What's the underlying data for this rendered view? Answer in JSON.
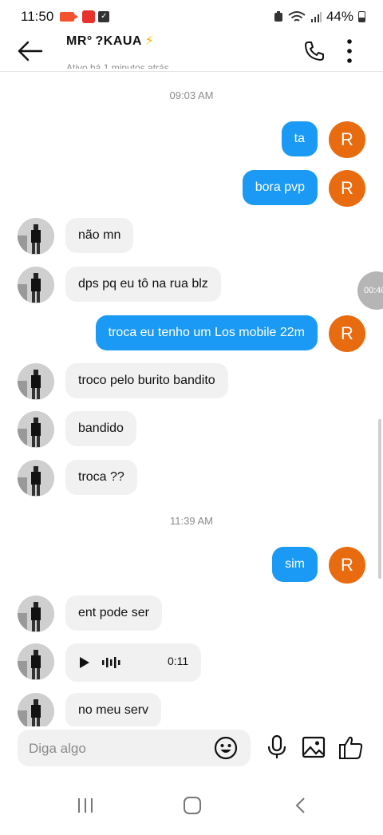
{
  "status_bar": {
    "time": "11:50",
    "battery": "44%"
  },
  "header": {
    "contact_name": "MR° ?KAUA ",
    "bolt": "⚡",
    "contact_status": "Ativo há 1 minutos atrás"
  },
  "chat": {
    "timestamp_1": "09:03 AM",
    "timestamp_2": "11:39 AM",
    "my_avatar_letter": "R",
    "floating_timer": "00:40",
    "messages": [
      {
        "dir": "out",
        "text": "ta"
      },
      {
        "dir": "out",
        "text": "bora pvp"
      },
      {
        "dir": "in",
        "text": "não mn"
      },
      {
        "dir": "in",
        "text": "dps pq eu tô na rua blz"
      },
      {
        "dir": "out",
        "text": "troca eu tenho um Los mobile 22m"
      },
      {
        "dir": "in",
        "text": "troco pelo burito bandito"
      },
      {
        "dir": "in",
        "text": "bandido"
      },
      {
        "dir": "in",
        "text": "troca ??"
      },
      {
        "dir": "out",
        "text": "sim"
      },
      {
        "dir": "in",
        "text": "ent pode ser"
      },
      {
        "dir": "in",
        "type": "voice",
        "duration": "0:11"
      },
      {
        "dir": "in",
        "text": "no meu serv"
      }
    ]
  },
  "input": {
    "placeholder": "Diga algo"
  },
  "icons": {
    "back": "arrow-left-icon",
    "call": "phone-icon",
    "more": "more-vertical-icon",
    "emoji": "smiley-icon",
    "mic": "microphone-icon",
    "image": "image-icon",
    "like": "thumbs-up-icon"
  },
  "colors": {
    "outgoing_bubble": "#1b9af5",
    "incoming_bubble": "#f1f1f1",
    "my_avatar": "#e96b10",
    "timestamp_text": "#8c8c8c"
  }
}
